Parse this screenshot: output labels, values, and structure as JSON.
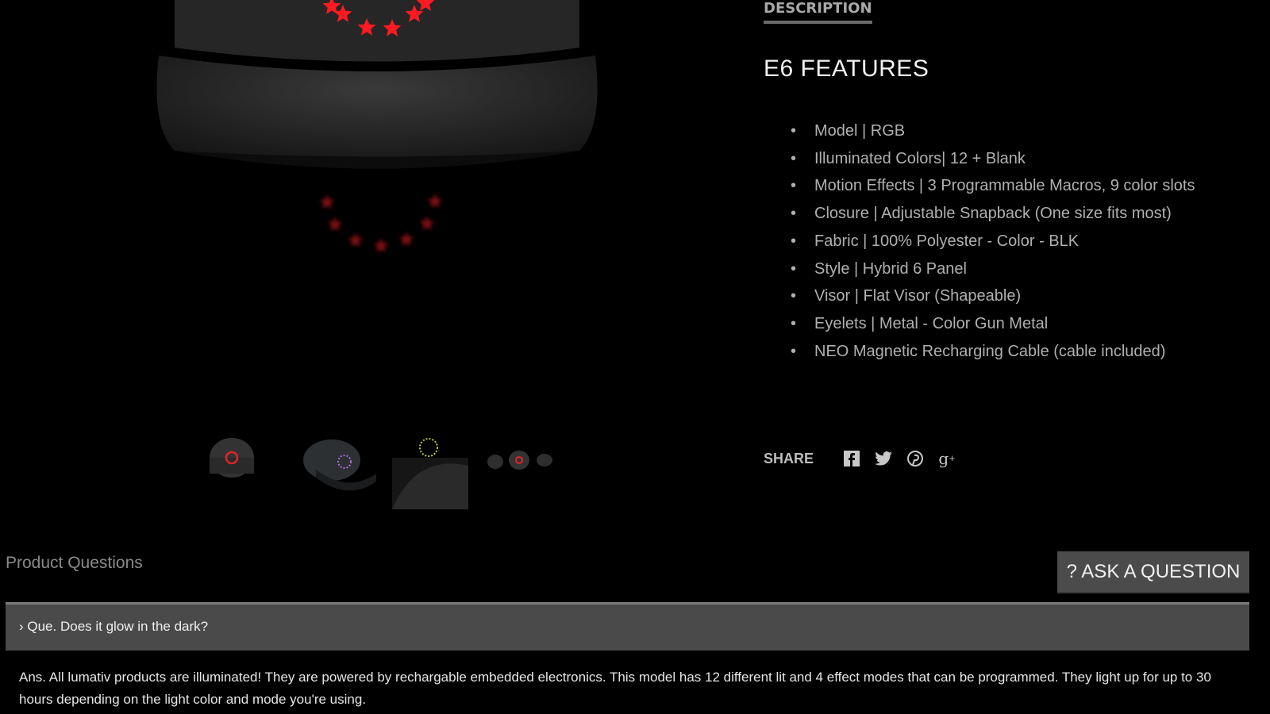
{
  "tabs": {
    "description": "DESCRIPTION"
  },
  "product": {
    "features_title": "E6 FEATURES",
    "features": [
      "Model | RGB",
      "Illuminated Colors| 12 + Blank",
      "Motion Effects |  3 Programmable Macros, 9 color slots",
      "Closure |  Adjustable Snapback (One size fits most)",
      "Fabric |  100% Polyester - Color - BLK",
      "Style | Hybrid 6 Panel",
      "Visor |  Flat Visor (Shapeable)",
      "Eyelets | Metal - Color Gun Metal",
      "NEO Magnetic Recharging Cable  (cable included)"
    ]
  },
  "share": {
    "label": "SHARE",
    "icons": [
      "facebook-icon",
      "twitter-icon",
      "pinterest-icon",
      "google-plus-icon"
    ]
  },
  "thumbnails": [
    {
      "ring_color": "#e0242a"
    },
    {
      "ring_color": "#b06ad8"
    },
    {
      "ring_color": "#b6d23a"
    },
    {
      "ring_color": "#e0242a"
    }
  ],
  "questions": {
    "title": "Product Questions",
    "ask_button": "? ASK A QUESTION",
    "items": [
      {
        "question": "› Que. Does it glow in the dark?",
        "answer": "Ans. All lumativ products are illuminated!  They are powered by rechargable embedded electronics.  This model has 12 different lit and 4 effect modes that can be programmed.  They light up for up to 30 hours depending on the light color and mode you're using."
      }
    ]
  },
  "colors": {
    "background": "#000000",
    "led": "#ff1a22",
    "button": "#4b4b4b"
  }
}
